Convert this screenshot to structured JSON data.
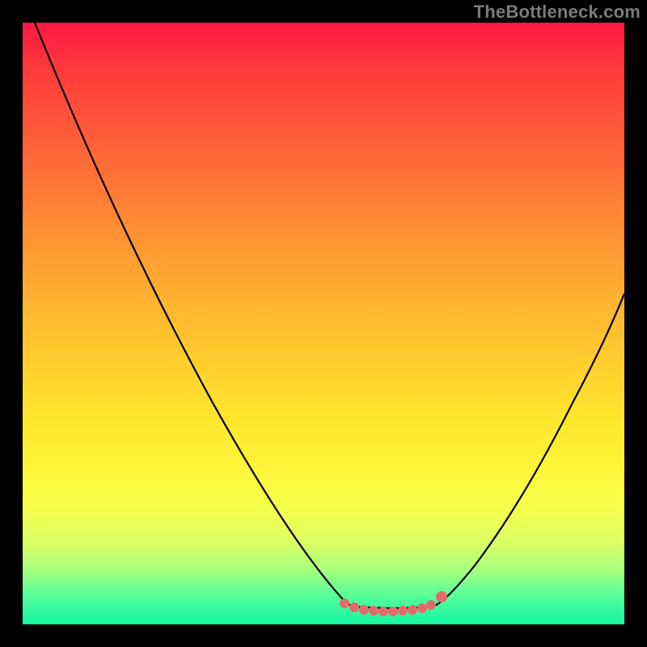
{
  "watermark": {
    "text": "TheBottleneck.com"
  },
  "chart_data": {
    "type": "line",
    "title": "",
    "xlabel": "",
    "ylabel": "",
    "xlim": [
      0,
      1
    ],
    "ylim": [
      0,
      1
    ],
    "series": [
      {
        "name": "left-descent",
        "x": [
          0.02,
          0.55
        ],
        "values": [
          1.0,
          0.03
        ]
      },
      {
        "name": "valley-floor",
        "x": [
          0.55,
          0.68
        ],
        "values": [
          0.03,
          0.03
        ]
      },
      {
        "name": "right-ascent",
        "x": [
          0.68,
          1.0
        ],
        "values": [
          0.03,
          0.55
        ]
      }
    ],
    "annotations": [
      {
        "name": "valley-marker",
        "shape": "dotted-arc",
        "x": [
          0.53,
          0.7
        ],
        "y": 0.035
      }
    ],
    "background_gradient": {
      "top": "#ff1744",
      "mid": "#ffe62e",
      "bottom": "#14f5a3"
    }
  }
}
